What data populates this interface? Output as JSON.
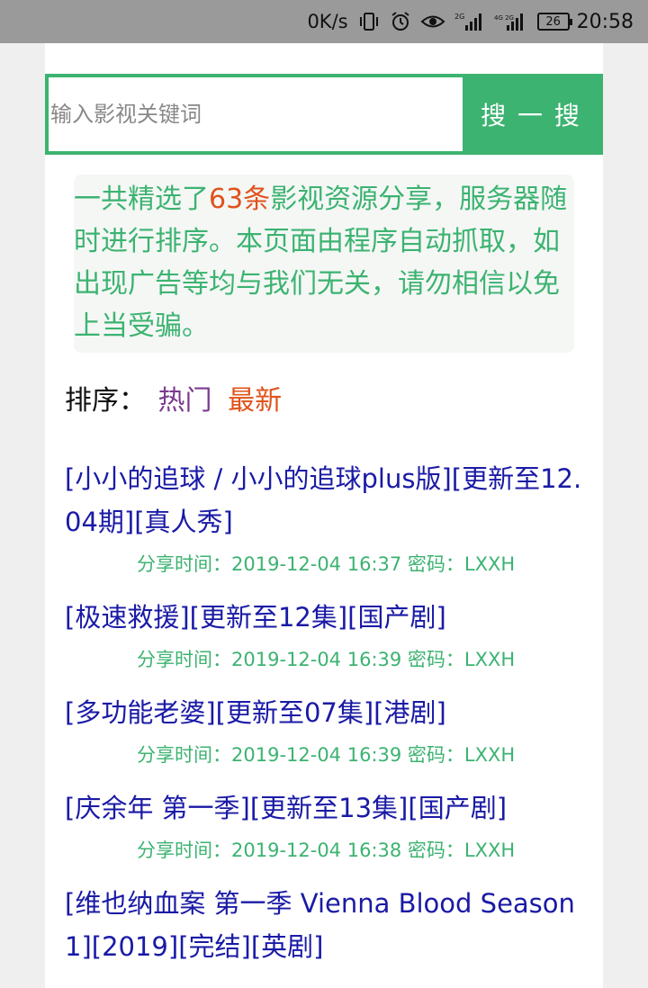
{
  "status_bar": {
    "net_speed": "0K/s",
    "signal_1": "2G",
    "signal_2": "4G 2G",
    "battery": "26",
    "time": "20:58"
  },
  "search": {
    "placeholder": "输入影视关键词",
    "button_label": "搜 一 搜"
  },
  "notice": {
    "prefix": "一共精选了",
    "count": "63条",
    "suffix": "影视资源分享，服务器随时进行排序。本页面由程序自动抓取，如出现广告等均与我们无关，请勿相信以免上当受骗。"
  },
  "sort": {
    "label": "排序：",
    "hot": "热门",
    "newest": "最新"
  },
  "items": [
    {
      "title": "[小小的追球 / 小小的追球plus版][更新至12.04期][真人秀]",
      "meta": "分享时间：2019-12-04 16:37 密码：LXXH"
    },
    {
      "title": "[极速救援][更新至12集][国产剧]",
      "meta": "分享时间：2019-12-04 16:39 密码：LXXH"
    },
    {
      "title": "[多功能老婆][更新至07集][港剧]",
      "meta": "分享时间：2019-12-04 16:39 密码：LXXH"
    },
    {
      "title": "[庆余年 第一季][更新至13集][国产剧]",
      "meta": "分享时间：2019-12-04 16:38 密码：LXXH"
    },
    {
      "title": "[维也纳血案 第一季 Vienna Blood Season 1][2019][完结][英剧]",
      "meta": ""
    }
  ],
  "colors": {
    "accent": "#3cb371",
    "highlight": "#e0521b",
    "link": "#1a1aa6",
    "hot": "#7b3a8e"
  }
}
